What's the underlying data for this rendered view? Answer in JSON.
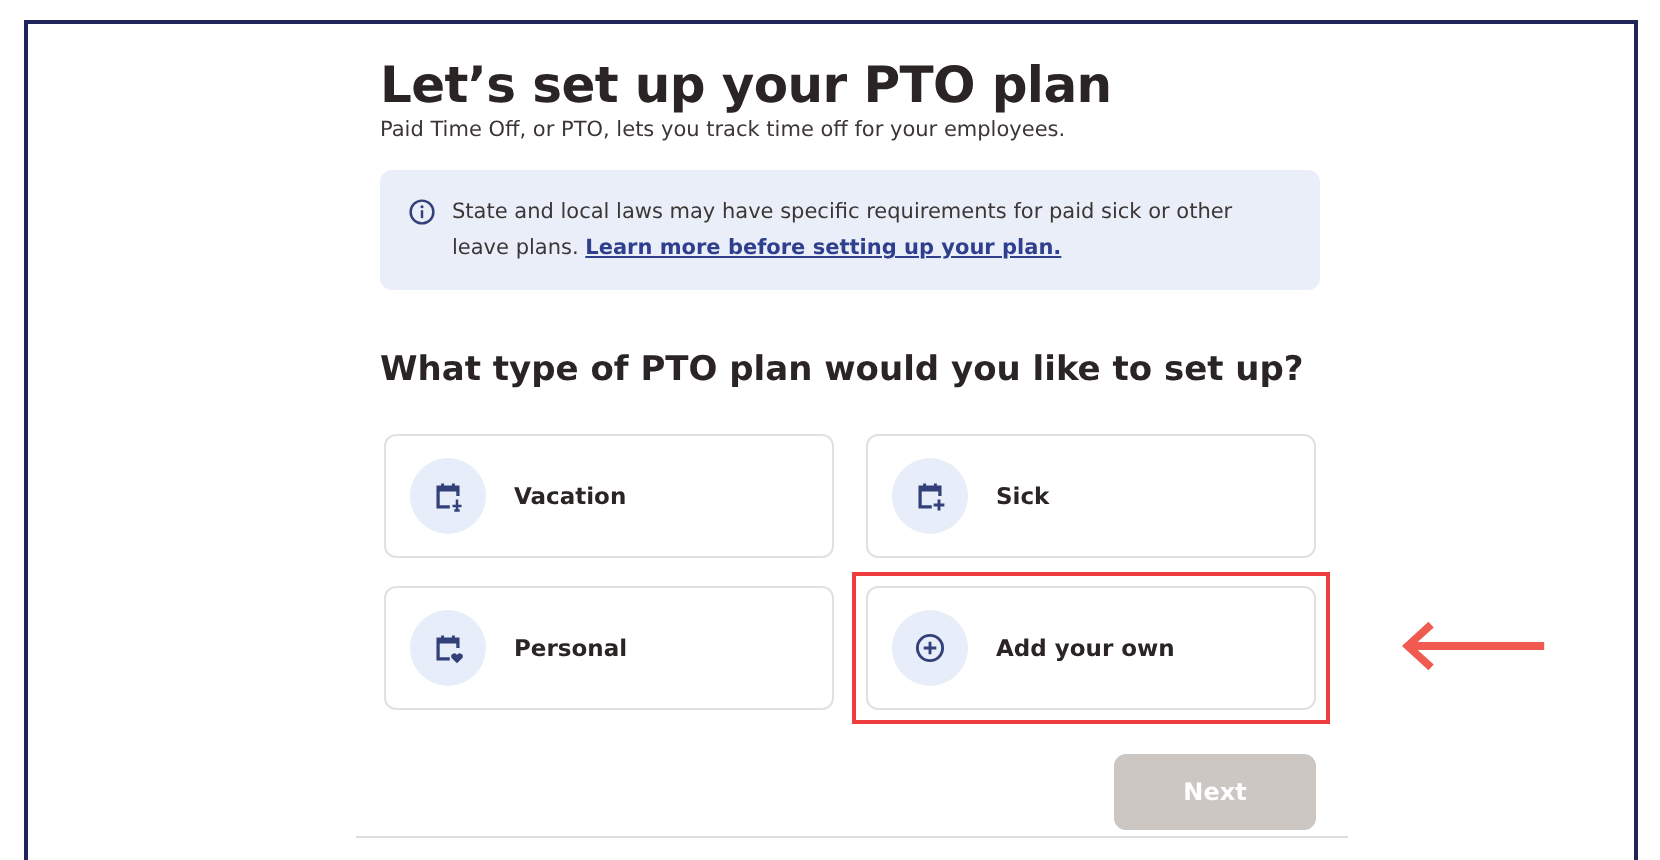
{
  "title": "Let’s set up your PTO plan",
  "subtitle": "Paid Time Off, or PTO, lets you track time off for your employees.",
  "notice": {
    "text": "State and local laws may have specific requirements for paid sick or other leave plans.",
    "link": "Learn more before setting up your plan."
  },
  "question": "What type of PTO plan would you like to set up?",
  "options": [
    {
      "label": "Vacation",
      "kind": "vacation",
      "highlighted": false
    },
    {
      "label": "Sick",
      "kind": "sick",
      "highlighted": false
    },
    {
      "label": "Personal",
      "kind": "personal",
      "highlighted": false
    },
    {
      "label": "Add your own",
      "kind": "add",
      "highlighted": true
    }
  ],
  "next_button": {
    "label": "Next",
    "disabled": true
  }
}
